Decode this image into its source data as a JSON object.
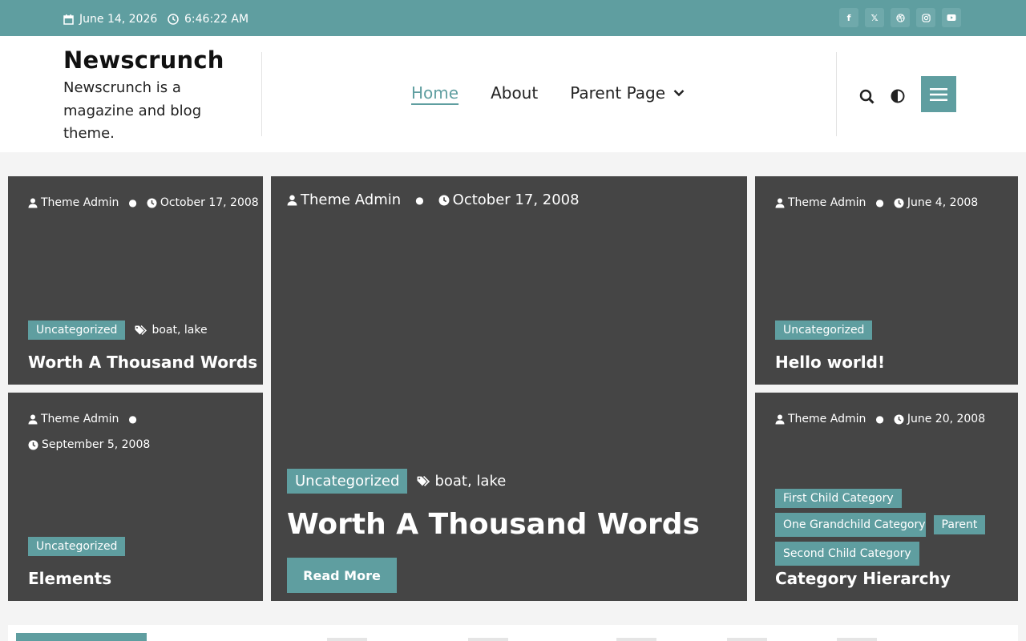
{
  "topbar": {
    "date": "June 14, 2026",
    "time": "6:46:22 AM",
    "socials": [
      "facebook-icon",
      "x-icon",
      "dribbble-icon",
      "instagram-icon",
      "youtube-icon"
    ]
  },
  "header": {
    "site_title": "Newscrunch",
    "site_description": "Newscrunch is a magazine and blog theme.",
    "nav": {
      "home": "Home",
      "about": "About",
      "parent_page": "Parent Page"
    }
  },
  "colors": {
    "accent": "#5f9ea0",
    "card_bg": "#454545",
    "page_bg": "#f4f4f4"
  },
  "cards": {
    "top_left": {
      "author": "Theme Admin",
      "date": "October 17, 2008",
      "category": "Uncategorized",
      "tags": "boat, lake",
      "title": "Worth A Thousand Words"
    },
    "bottom_left": {
      "author": "Theme Admin",
      "date": "September 5, 2008",
      "category": "Uncategorized",
      "title": "Elements"
    },
    "featured": {
      "author": "Theme Admin",
      "date": "October 17, 2008",
      "category": "Uncategorized",
      "tags": "boat, lake",
      "title": "Worth A Thousand Words",
      "read_more": "Read More"
    },
    "top_right": {
      "author": "Theme Admin",
      "date": "June 4, 2008",
      "category": "Uncategorized",
      "title": "Hello world!"
    },
    "bottom_right": {
      "author": "Theme Admin",
      "date": "June 20, 2008",
      "categories": [
        "First Child Category",
        "One Grandchild Category",
        "Parent",
        "Second Child Category"
      ],
      "title": "Category Hierarchy"
    }
  }
}
